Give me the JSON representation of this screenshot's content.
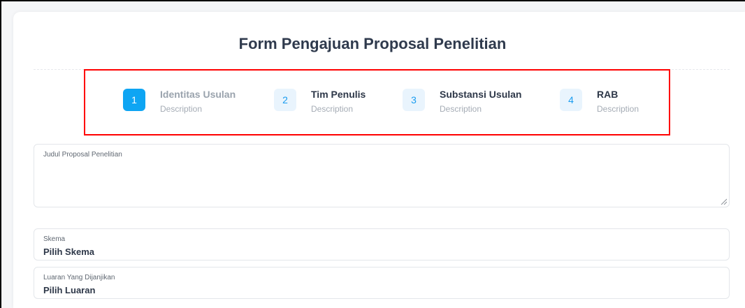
{
  "form": {
    "title": "Form Pengajuan Proposal Penelitian"
  },
  "steps": [
    {
      "number": "1",
      "title": "Identitas Usulan",
      "description": "Description",
      "active": true
    },
    {
      "number": "2",
      "title": "Tim Penulis",
      "description": "Description",
      "active": false
    },
    {
      "number": "3",
      "title": "Substansi Usulan",
      "description": "Description",
      "active": false
    },
    {
      "number": "4",
      "title": "RAB",
      "description": "Description",
      "active": false
    }
  ],
  "fields": {
    "judul": {
      "label": "Judul Proposal Penelitian",
      "value": ""
    },
    "skema": {
      "label": "Skema",
      "value": "Pilih Skema"
    },
    "luaran": {
      "label": "Luaran Yang Dijanjikan",
      "value": "Pilih Luaran"
    }
  },
  "colors": {
    "accent": "#0ea5f3",
    "highlight_box": "#ff0000"
  }
}
